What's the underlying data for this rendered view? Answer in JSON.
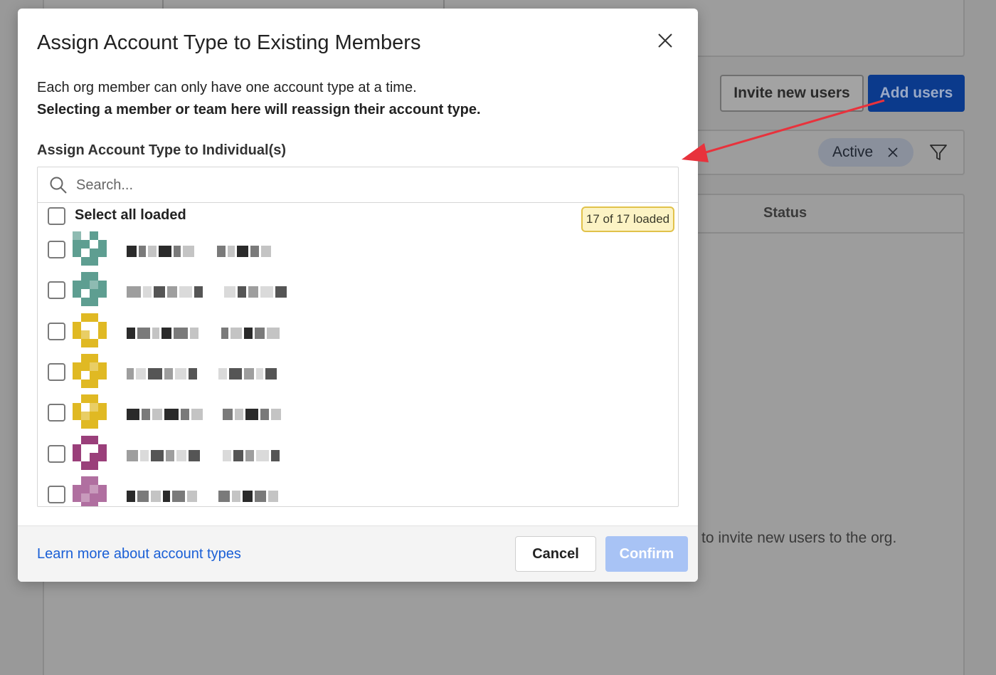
{
  "background": {
    "buttons": {
      "invite_label": "Invite new users",
      "add_label": "Add users"
    },
    "filter_chip_label": "Active",
    "table": {
      "status_header": "Status",
      "empty_text": "to invite new users to the org."
    }
  },
  "modal": {
    "title": "Assign Account Type to Existing Members",
    "description_line1": "Each org member can only have one account type at a time.",
    "description_line2": "Selecting a member or team here will reassign their account type.",
    "section_label": "Assign Account Type to Individual(s)",
    "search": {
      "placeholder": "Search..."
    },
    "select_all_label": "Select all loaded",
    "loaded_badge": "17 of 17 loaded",
    "members": [
      {
        "avatar_color": "#5e9e91"
      },
      {
        "avatar_color": "#5e9e91"
      },
      {
        "avatar_color": "#e0b923"
      },
      {
        "avatar_color": "#e0b923"
      },
      {
        "avatar_color": "#e0b923"
      },
      {
        "avatar_color": "#9a3f7a"
      },
      {
        "avatar_color": "#b06fa0"
      }
    ],
    "footer": {
      "learn_more_link": "Learn more about account types",
      "cancel_label": "Cancel",
      "confirm_label": "Confirm"
    }
  },
  "colors": {
    "primary": "#0b52d1",
    "link": "#1a5fd6",
    "annotation_arrow": "#e8323c"
  }
}
